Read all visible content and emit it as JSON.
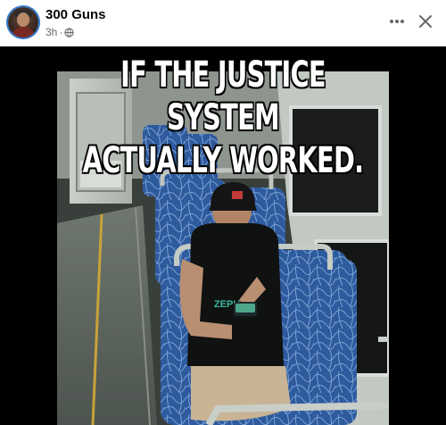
{
  "post": {
    "author": "300 Guns",
    "timestamp": "3h",
    "separator": "·",
    "audience_icon": "globe-icon",
    "more_icon": "more-options-icon",
    "close_icon": "close-icon"
  },
  "meme": {
    "caption_line1": "IF THE JUSTICE SYSTEM",
    "caption_line2": "ACTUALLY WORKED.",
    "shirt_text": "ZEPHYR",
    "cap_logo_text": "ZEPHYR"
  },
  "colors": {
    "avatar_ring": "#2f76c9",
    "name_text": "#050505",
    "meta_text": "#65676b",
    "image_background": "#000000"
  }
}
